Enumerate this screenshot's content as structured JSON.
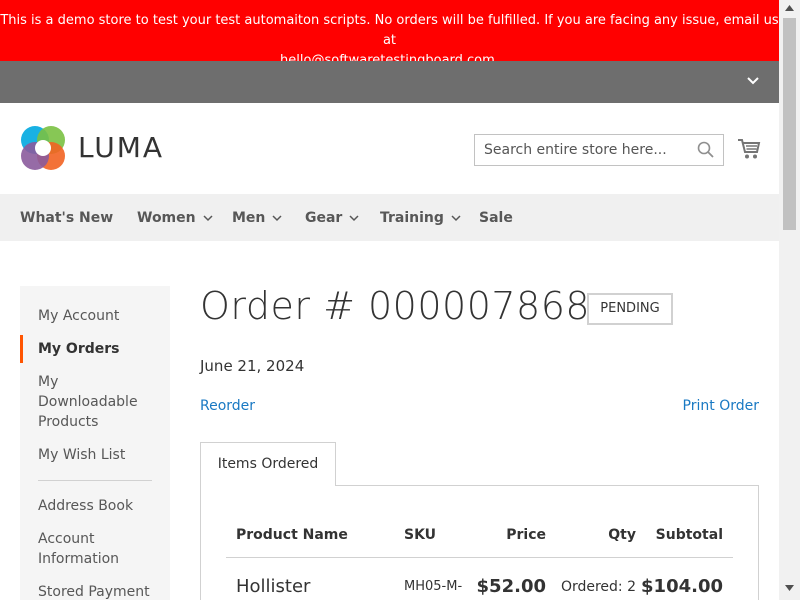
{
  "banner": {
    "line1": "This is a demo store to test your test automaiton scripts. No orders will be fulfilled. If you are facing any issue, email us at",
    "line2": "hello@softwaretestingboard.com."
  },
  "header": {
    "logo_text": "LUMA",
    "search_placeholder": "Search entire store here...",
    "icons": [
      "chevron-down-icon",
      "search-icon",
      "cart-icon"
    ]
  },
  "nav": {
    "items": [
      {
        "label": "What's New",
        "has_dropdown": false
      },
      {
        "label": "Women",
        "has_dropdown": true
      },
      {
        "label": "Men",
        "has_dropdown": true
      },
      {
        "label": "Gear",
        "has_dropdown": true
      },
      {
        "label": "Training",
        "has_dropdown": true
      },
      {
        "label": "Sale",
        "has_dropdown": false
      }
    ]
  },
  "sidebar": {
    "items": [
      {
        "label": "My Account"
      },
      {
        "label": "My Orders",
        "active": true
      },
      {
        "label": "My Downloadable Products"
      },
      {
        "label": "My Wish List"
      },
      {
        "label": "Address Book"
      },
      {
        "label": "Account Information"
      },
      {
        "label": "Stored Payment"
      }
    ]
  },
  "order": {
    "title": "Order # 000007868",
    "status": "PENDING",
    "date": "June 21, 2024",
    "reorder_label": "Reorder",
    "print_label": "Print Order",
    "tab_label": "Items Ordered"
  },
  "table": {
    "headers": [
      "Product Name",
      "SKU",
      "Price",
      "Qty",
      "Subtotal"
    ],
    "rows": [
      {
        "product": "Hollister",
        "sku": "MH05-M-",
        "price": "$52.00",
        "qty": "Ordered: 2",
        "subtotal": "$104.00"
      }
    ]
  },
  "colors": {
    "banner": "#ff0000",
    "link": "#1979c3",
    "active_marker": "#ff5501"
  }
}
